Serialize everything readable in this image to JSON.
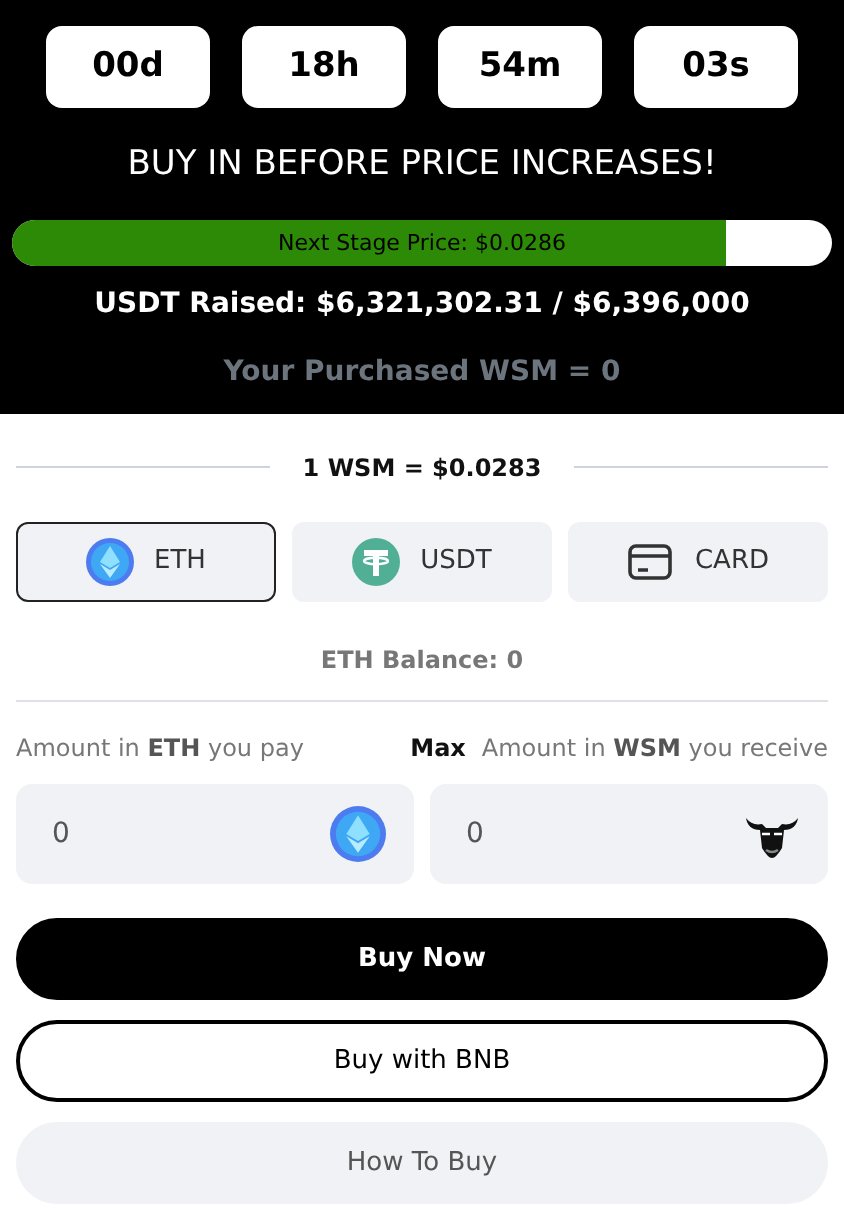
{
  "countdown": [
    {
      "value": "00d"
    },
    {
      "value": "18h"
    },
    {
      "value": "54m"
    },
    {
      "value": "03s"
    }
  ],
  "headline": "BUY IN BEFORE PRICE INCREASES!",
  "progress": {
    "label": "Next Stage Price: $0.0286",
    "level": 0.87
  },
  "raised": "USDT Raised: $6,321,302.31 / $6,396,000",
  "purchased": "Your Purchased WSM = 0",
  "rate": "1 WSM = $0.0283",
  "tabs": [
    {
      "label": "ETH",
      "kind": "eth",
      "selected": true
    },
    {
      "label": "USDT",
      "kind": "usdt",
      "selected": false
    },
    {
      "label": "CARD",
      "kind": "card",
      "selected": false
    }
  ],
  "balance": "ETH Balance: 0",
  "pay": {
    "label": "Amount in **ETH** you pay",
    "max": "Max",
    "value": "0",
    "kind": "eth"
  },
  "receive": {
    "label": "Amount in **WSM** you receive",
    "value": "0",
    "kind": "bull"
  },
  "buttons": [
    {
      "label": "Buy Now",
      "kind": "primary"
    },
    {
      "label": "Buy with BNB",
      "kind": "outline"
    },
    {
      "label": "How To Buy",
      "kind": "muted"
    }
  ]
}
